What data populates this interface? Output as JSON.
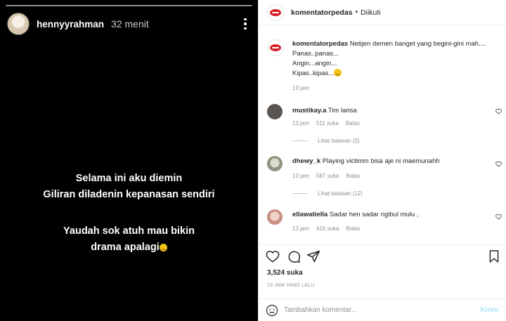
{
  "story": {
    "username": "hennyyrahman",
    "time": "32 menit",
    "text_block_1": [
      "Selama ini aku diemin",
      "Giliran diladenin kepanasan sendiri"
    ],
    "text_block_2": [
      "Yaudah sok atuh mau bikin",
      "drama apalagi"
    ],
    "emoji": "grinning-face-emoji"
  },
  "post": {
    "header": {
      "username": "komentatorpedas",
      "separator": "•",
      "follow_status": "Diikuti"
    },
    "caption": {
      "username": "komentatorpedas",
      "lines": [
        "Netijen demen banget yang begini-gini mah....",
        "Panas..panas...",
        "Angin...angin...",
        "Kipas..kipas..."
      ],
      "time": "13 jam"
    },
    "comments": [
      {
        "username": "mustikay.a",
        "text": "Tim larisa",
        "time": "13 jam",
        "likes": "511 suka",
        "reply": "Balas",
        "view_replies": "Lihat balasan (2)",
        "avatar_color": "#5a5550"
      },
      {
        "username": "dhewy_k",
        "text": "Playing victimm bisa aje ni maemunahh",
        "time": "13 jam",
        "likes": "587 suka",
        "reply": "Balas",
        "view_replies": "Lihat balasan (12)",
        "avatar_color": "#9aa08a"
      },
      {
        "username": "ellawatiella",
        "text": "Sadar hen sadar ngibul mulu ,",
        "time": "13 jam",
        "likes": "416 suka",
        "reply": "Balas",
        "avatar_color": "#d9a9a0"
      }
    ],
    "likes_count": "3,524 suka",
    "posted_ago": "13 JAM YANG LALU",
    "add_comment": {
      "placeholder": "Tambahkan komentar...",
      "post_label": "Kirim"
    },
    "colors": {
      "brand_red": "#d61f26",
      "muted_text": "#8e8e8e",
      "post_button_disabled": "#b2dffc"
    }
  }
}
